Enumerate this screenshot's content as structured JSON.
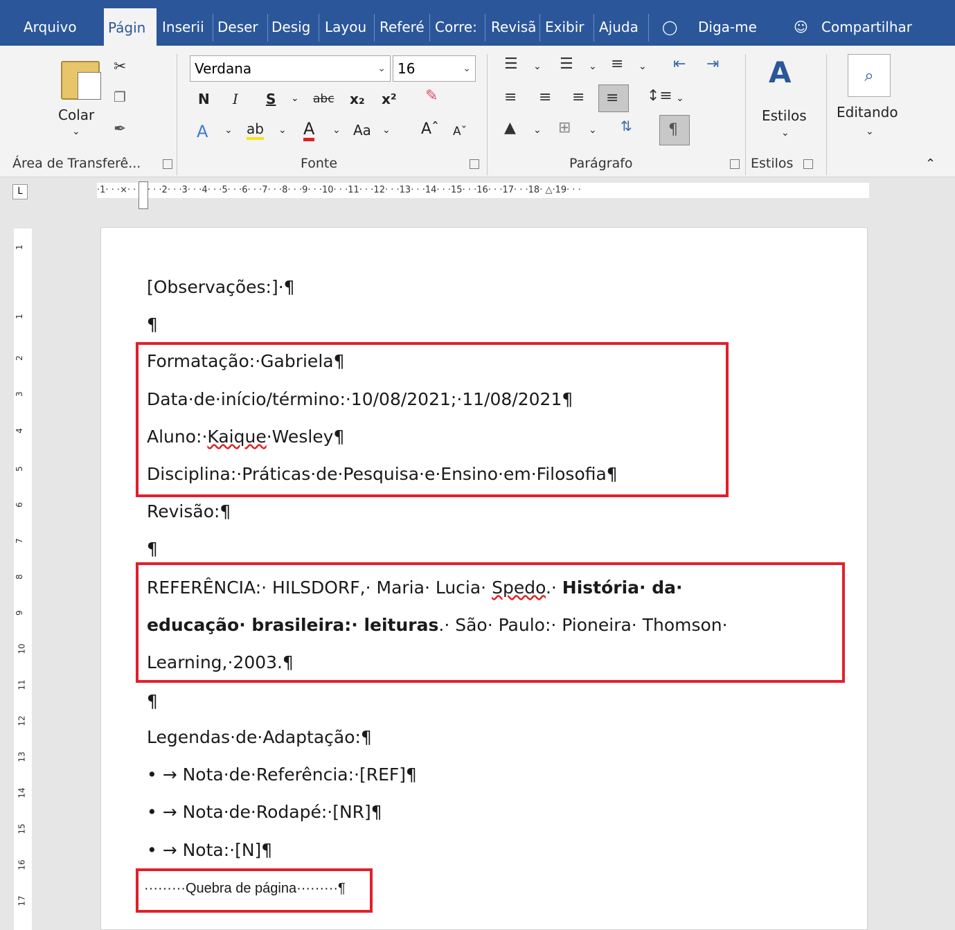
{
  "tabs": [
    "Arquivo",
    "Págin",
    "Inserii",
    "Deser",
    "Desig",
    "Layou",
    "Referé",
    "Corre:",
    "Revisã",
    "Exibir",
    "Ajuda"
  ],
  "tellme": "Diga-me",
  "share": "Compartilhar",
  "clipboard": {
    "paste": "Colar",
    "label": "Área de Transferê..."
  },
  "font": {
    "name": "Verdana",
    "size": "16",
    "label": "Fonte",
    "bold": "N",
    "italic": "I",
    "underline": "S",
    "strike": "abc",
    "aa": "Aa"
  },
  "paragraph": {
    "label": "Parágrafo"
  },
  "styles": {
    "button": "Estilos",
    "label": "Estilos"
  },
  "editing": {
    "button": "Editando"
  },
  "ruler": "·1· · ·⨯· · ·1· · ·2· · ·3· · ·4· · ·5· · ·6· · ·7· · ·8· · ·9· · ·10· · ·11· · ·12· · ·13· · ·14· · ·15· · ·16· · ·17· · ·18· △·19· · ·",
  "doc": {
    "obs": "[Observações:]·¶",
    "pil": "¶",
    "formatacao": "Formatação:·Gabriela¶",
    "data": "Data·de·início/término:·10/08/2021;·11/08/2021¶",
    "aluno_a": "Aluno:·",
    "aluno_b": "Kaique",
    "aluno_c": "·Wesley¶",
    "disciplina": "Disciplina:·Práticas·de·Pesquisa·e·Ensino·em·Filosofia¶",
    "revisao": "Revisão:¶",
    "ref1a": "REFERÊNCIA:·  HILSDORF,·  Maria·  Lucia·  ",
    "ref1b": "Spedo",
    "ref1c": ".·  ",
    "ref1d": "História·  da·",
    "ref2a": "educação· brasileira:· leituras",
    "ref2b": ".· São· Paulo:· Pioneira· Thomson·",
    "ref3": "Learning,·2003.¶",
    "legendas": "Legendas·de·Adaptação:¶",
    "l1": "•  →  Nota·de·Referência:·[REF]¶",
    "l2": "•  →  Nota·de·Rodapé:·[NR]¶",
    "l3": "•  →  Nota:·[N]¶",
    "quebra": "·········Quebra de página·········¶"
  }
}
